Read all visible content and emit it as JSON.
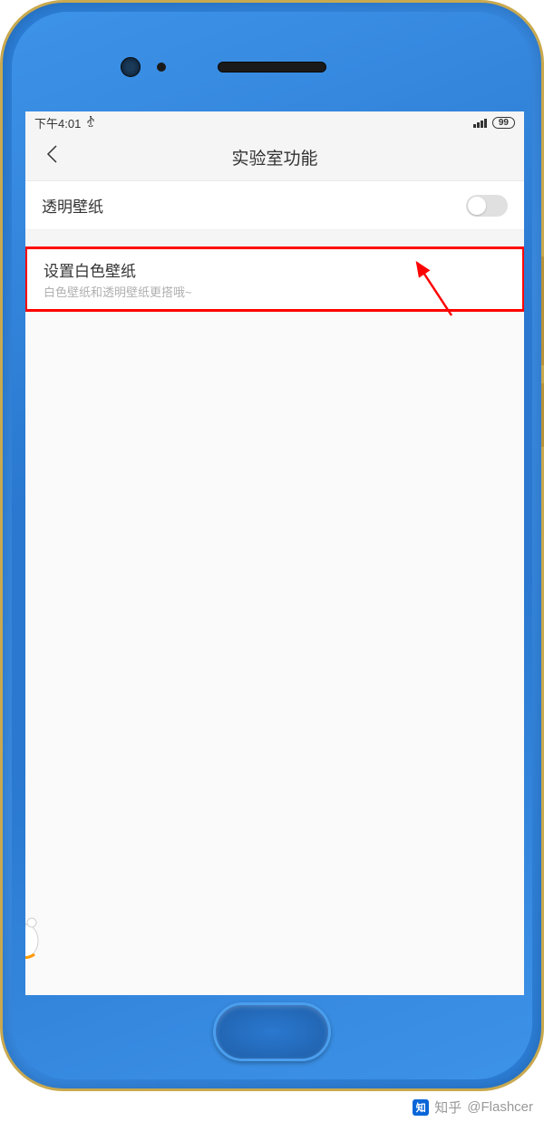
{
  "status_bar": {
    "time": "下午4:01",
    "battery": "99"
  },
  "header": {
    "title": "实验室功能"
  },
  "settings": {
    "transparent_wallpaper": {
      "label": "透明壁纸",
      "enabled": false
    },
    "white_wallpaper": {
      "title": "设置白色壁纸",
      "subtitle": "白色壁纸和透明壁纸更搭哦~"
    }
  },
  "watermark": {
    "platform": "知乎",
    "author": "@Flashcer"
  }
}
